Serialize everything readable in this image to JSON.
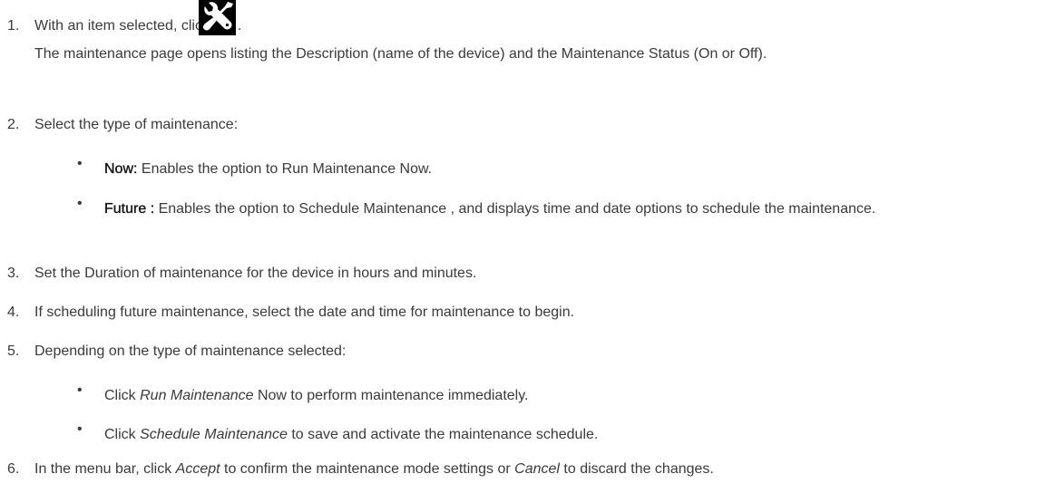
{
  "step1": {
    "number": "1.",
    "text_before_icon": "With an item selected, click",
    "icon": "maintenance-tools-icon",
    "text_after_icon": ".",
    "description": "The maintenance page opens listing the Description (name of the device) and the Maintenance Status (On or Off)."
  },
  "step2": {
    "number": "2.",
    "text": "Select the type of maintenance:",
    "bullets": [
      {
        "term": "Now:",
        "text": " Enables the option to Run Maintenance Now."
      },
      {
        "term": "Future :",
        "text": " Enables the option to Schedule Maintenance , and displays time and date options to schedule the maintenance."
      }
    ]
  },
  "step3": {
    "number": "3.",
    "text": "Set the Duration of maintenance for the device in hours and minutes."
  },
  "step4": {
    "number": "4.",
    "text": "If scheduling future maintenance, select the date and time for maintenance to begin."
  },
  "step5": {
    "number": "5.",
    "text": "Depending on the type of maintenance selected:",
    "bullets": [
      {
        "prefix": "Click ",
        "em": "Run Maintenance",
        "suffix": " Now to perform maintenance immediately."
      },
      {
        "prefix": "Click ",
        "em": "Schedule Maintenance",
        "suffix": " to save and activate the maintenance schedule."
      }
    ]
  },
  "step6": {
    "number": "6.",
    "prefix": "In the menu bar, click ",
    "em1": "Accept",
    "middle": " to confirm the maintenance mode settings or ",
    "em2": "Cancel",
    "suffix": " to discard the changes."
  },
  "bullet_glyph": "•",
  "colors": {
    "text": "#3a3a3a",
    "bold_text": "#111111",
    "icon_background": "#000000",
    "icon_foreground": "#ffffff"
  }
}
